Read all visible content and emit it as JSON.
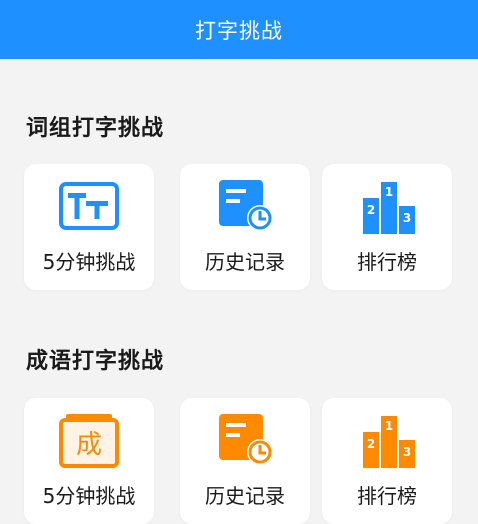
{
  "header": {
    "title": "打字挑战"
  },
  "colors": {
    "header": "#1e90ff",
    "blue_icon": "#1e90ff",
    "orange_icon": "#ff8a00"
  },
  "sections": [
    {
      "title": "词组打字挑战",
      "color": "#1e90ff",
      "cards": [
        {
          "label": "5分钟挑战",
          "icon": "tt-text-icon"
        },
        {
          "label": "历史记录",
          "icon": "history-clock-icon"
        },
        {
          "label": "排行榜",
          "icon": "podium-icon",
          "podium": [
            "2",
            "1",
            "3"
          ]
        }
      ]
    },
    {
      "title": "成语打字挑战",
      "color": "#ff8a00",
      "cards": [
        {
          "label": "5分钟挑战",
          "icon": "cheng-character-icon",
          "glyph": "成"
        },
        {
          "label": "历史记录",
          "icon": "history-clock-icon"
        },
        {
          "label": "排行榜",
          "icon": "podium-icon",
          "podium": [
            "2",
            "1",
            "3"
          ]
        }
      ]
    }
  ]
}
